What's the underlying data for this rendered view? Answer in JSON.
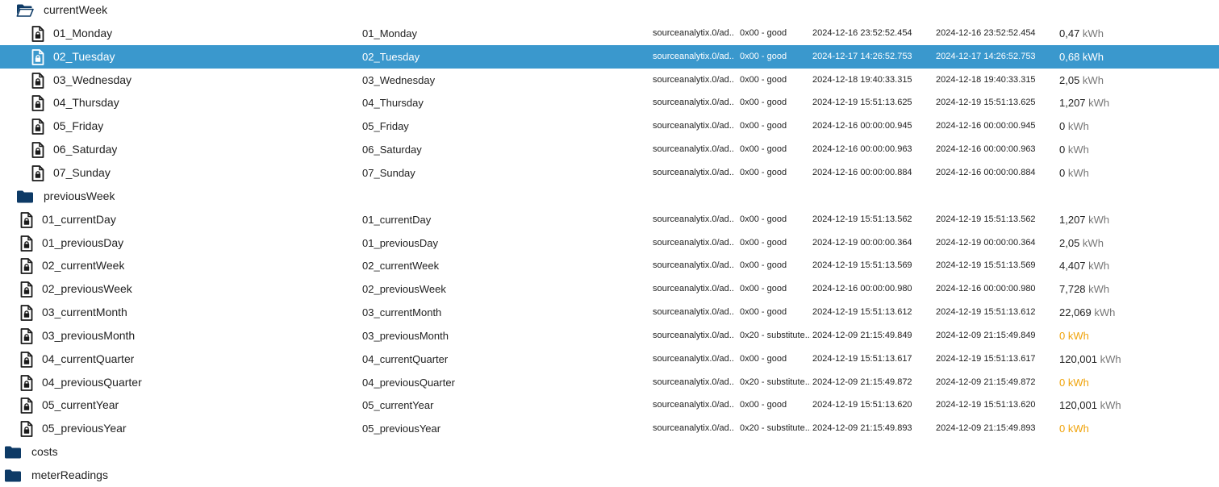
{
  "colors": {
    "selected_row_bg": "#3a98cd",
    "folder_icon": "#0d3a66",
    "file_icon": "#1a1a1a",
    "value_warning": "#f0a30a",
    "unit_text": "#777777"
  },
  "rows": [
    {
      "type": "folder",
      "icon": "folder-open-icon",
      "indent": 1,
      "name": "currentWeek"
    },
    {
      "type": "state",
      "icon": "file-lock-icon",
      "indent": 2,
      "name": "01_Monday",
      "name2": "01_Monday",
      "source": "sourceanalytix.0/ad...",
      "quality": "0x00 - good",
      "ts": "2024-12-16 23:52:52.454",
      "lc": "2024-12-16 23:52:52.454",
      "value": "0,47",
      "unit": "kWh",
      "warn": false,
      "selected": false
    },
    {
      "type": "state",
      "icon": "file-lock-icon",
      "indent": 2,
      "name": "02_Tuesday",
      "name2": "02_Tuesday",
      "source": "sourceanalytix.0/ad...",
      "quality": "0x00 - good",
      "ts": "2024-12-17 14:26:52.753",
      "lc": "2024-12-17 14:26:52.753",
      "value": "0,68",
      "unit": "kWh",
      "warn": false,
      "selected": true
    },
    {
      "type": "state",
      "icon": "file-lock-icon",
      "indent": 2,
      "name": "03_Wednesday",
      "name2": "03_Wednesday",
      "source": "sourceanalytix.0/ad...",
      "quality": "0x00 - good",
      "ts": "2024-12-18 19:40:33.315",
      "lc": "2024-12-18 19:40:33.315",
      "value": "2,05",
      "unit": "kWh",
      "warn": false,
      "selected": false
    },
    {
      "type": "state",
      "icon": "file-lock-icon",
      "indent": 2,
      "name": "04_Thursday",
      "name2": "04_Thursday",
      "source": "sourceanalytix.0/ad...",
      "quality": "0x00 - good",
      "ts": "2024-12-19 15:51:13.625",
      "lc": "2024-12-19 15:51:13.625",
      "value": "1,207",
      "unit": "kWh",
      "warn": false,
      "selected": false
    },
    {
      "type": "state",
      "icon": "file-lock-icon",
      "indent": 2,
      "name": "05_Friday",
      "name2": "05_Friday",
      "source": "sourceanalytix.0/ad...",
      "quality": "0x00 - good",
      "ts": "2024-12-16 00:00:00.945",
      "lc": "2024-12-16 00:00:00.945",
      "value": "0",
      "unit": "kWh",
      "warn": false,
      "selected": false
    },
    {
      "type": "state",
      "icon": "file-lock-icon",
      "indent": 2,
      "name": "06_Saturday",
      "name2": "06_Saturday",
      "source": "sourceanalytix.0/ad...",
      "quality": "0x00 - good",
      "ts": "2024-12-16 00:00:00.963",
      "lc": "2024-12-16 00:00:00.963",
      "value": "0",
      "unit": "kWh",
      "warn": false,
      "selected": false
    },
    {
      "type": "state",
      "icon": "file-lock-icon",
      "indent": 2,
      "name": "07_Sunday",
      "name2": "07_Sunday",
      "source": "sourceanalytix.0/ad...",
      "quality": "0x00 - good",
      "ts": "2024-12-16 00:00:00.884",
      "lc": "2024-12-16 00:00:00.884",
      "value": "0",
      "unit": "kWh",
      "warn": false,
      "selected": false
    },
    {
      "type": "folder",
      "icon": "folder-icon",
      "indent": 1,
      "name": "previousWeek"
    },
    {
      "type": "state",
      "icon": "file-lock-icon",
      "indent": 1,
      "name": "01_currentDay",
      "name2": "01_currentDay",
      "source": "sourceanalytix.0/ad...",
      "quality": "0x00 - good",
      "ts": "2024-12-19 15:51:13.562",
      "lc": "2024-12-19 15:51:13.562",
      "value": "1,207",
      "unit": "kWh",
      "warn": false,
      "selected": false
    },
    {
      "type": "state",
      "icon": "file-lock-icon",
      "indent": 1,
      "name": "01_previousDay",
      "name2": "01_previousDay",
      "source": "sourceanalytix.0/ad...",
      "quality": "0x00 - good",
      "ts": "2024-12-19 00:00:00.364",
      "lc": "2024-12-19 00:00:00.364",
      "value": "2,05",
      "unit": "kWh",
      "warn": false,
      "selected": false
    },
    {
      "type": "state",
      "icon": "file-lock-icon",
      "indent": 1,
      "name": "02_currentWeek",
      "name2": "02_currentWeek",
      "source": "sourceanalytix.0/ad...",
      "quality": "0x00 - good",
      "ts": "2024-12-19 15:51:13.569",
      "lc": "2024-12-19 15:51:13.569",
      "value": "4,407",
      "unit": "kWh",
      "warn": false,
      "selected": false
    },
    {
      "type": "state",
      "icon": "file-lock-icon",
      "indent": 1,
      "name": "02_previousWeek",
      "name2": "02_previousWeek",
      "source": "sourceanalytix.0/ad...",
      "quality": "0x00 - good",
      "ts": "2024-12-16 00:00:00.980",
      "lc": "2024-12-16 00:00:00.980",
      "value": "7,728",
      "unit": "kWh",
      "warn": false,
      "selected": false
    },
    {
      "type": "state",
      "icon": "file-lock-icon",
      "indent": 1,
      "name": "03_currentMonth",
      "name2": "03_currentMonth",
      "source": "sourceanalytix.0/ad...",
      "quality": "0x00 - good",
      "ts": "2024-12-19 15:51:13.612",
      "lc": "2024-12-19 15:51:13.612",
      "value": "22,069",
      "unit": "kWh",
      "warn": false,
      "selected": false
    },
    {
      "type": "state",
      "icon": "file-lock-icon",
      "indent": 1,
      "name": "03_previousMonth",
      "name2": "03_previousMonth",
      "source": "sourceanalytix.0/ad...",
      "quality": "0x20 - substitute...",
      "ts": "2024-12-09 21:15:49.849",
      "lc": "2024-12-09 21:15:49.849",
      "value": "0",
      "unit": "kWh",
      "warn": true,
      "selected": false
    },
    {
      "type": "state",
      "icon": "file-lock-icon",
      "indent": 1,
      "name": "04_currentQuarter",
      "name2": "04_currentQuarter",
      "source": "sourceanalytix.0/ad...",
      "quality": "0x00 - good",
      "ts": "2024-12-19 15:51:13.617",
      "lc": "2024-12-19 15:51:13.617",
      "value": "120,001",
      "unit": "kWh",
      "warn": false,
      "selected": false
    },
    {
      "type": "state",
      "icon": "file-lock-icon",
      "indent": 1,
      "name": "04_previousQuarter",
      "name2": "04_previousQuarter",
      "source": "sourceanalytix.0/ad...",
      "quality": "0x20 - substitute...",
      "ts": "2024-12-09 21:15:49.872",
      "lc": "2024-12-09 21:15:49.872",
      "value": "0",
      "unit": "kWh",
      "warn": true,
      "selected": false
    },
    {
      "type": "state",
      "icon": "file-lock-icon",
      "indent": 1,
      "name": "05_currentYear",
      "name2": "05_currentYear",
      "source": "sourceanalytix.0/ad...",
      "quality": "0x00 - good",
      "ts": "2024-12-19 15:51:13.620",
      "lc": "2024-12-19 15:51:13.620",
      "value": "120,001",
      "unit": "kWh",
      "warn": false,
      "selected": false
    },
    {
      "type": "state",
      "icon": "file-lock-icon",
      "indent": 1,
      "name": "05_previousYear",
      "name2": "05_previousYear",
      "source": "sourceanalytix.0/ad...",
      "quality": "0x20 - substitute...",
      "ts": "2024-12-09 21:15:49.893",
      "lc": "2024-12-09 21:15:49.893",
      "value": "0",
      "unit": "kWh",
      "warn": true,
      "selected": false
    },
    {
      "type": "folder",
      "icon": "folder-icon",
      "indent": 0,
      "name": "costs"
    },
    {
      "type": "folder",
      "icon": "folder-icon",
      "indent": 0,
      "name": "meterReadings"
    }
  ]
}
